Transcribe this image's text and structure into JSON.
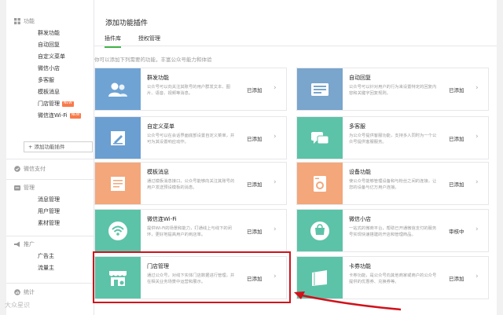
{
  "sidebar": {
    "sections": [
      {
        "label": "功能",
        "icon": "grid-icon"
      },
      {
        "label": "微信支付",
        "icon": "wallet-icon"
      },
      {
        "label": "管理",
        "icon": "folder-icon"
      },
      {
        "label": "推广",
        "icon": "megaphone-icon"
      },
      {
        "label": "统计",
        "icon": "chart-icon"
      }
    ],
    "items": [
      "群发功能",
      "自动回复",
      "自定义菜单",
      "微信小店",
      "多客服",
      "模板消息",
      "门店管理",
      "微信连Wi-Fi"
    ],
    "item_badges": {
      "6": "NEW",
      "7": "NEW"
    },
    "add_plugin": "+ 添加功能插件",
    "manage_items": [
      "消息管理",
      "用户管理",
      "素材管理"
    ],
    "promo_items": [
      "广告主",
      "流量主"
    ]
  },
  "main": {
    "title": "添加功能插件",
    "tabs": [
      "插件库",
      "授权管理"
    ],
    "intro": "你可以添加下列需要的功能，丰富公众号能力和体验"
  },
  "cards": [
    {
      "title": "群发功能",
      "desc": "公众号可以向关注其账号的用户群发文本、图片、语音、视频等消息。",
      "status": "已添加",
      "icon": "users-icon",
      "color": "#6fa3d4"
    },
    {
      "title": "自动回复",
      "desc": "公众号可以针对用户的行为来设置特定的回复内容和关键字回复规则。",
      "status": "已添加",
      "icon": "reply-icon",
      "color": "#7aa5cc"
    },
    {
      "title": "自定义菜单",
      "desc": "公众号可以在会话界面底部设置自定义菜单，并可为其设置响应动作。",
      "status": "已添加",
      "icon": "pencil-icon",
      "color": "#6b9ed1"
    },
    {
      "title": "多客服",
      "desc": "为公众号提供客服功能，支持多人同时为一个公众号提供客服服务。",
      "status": "已添加",
      "icon": "chat-icon",
      "color": "#5cc3a8"
    },
    {
      "title": "模板消息",
      "desc": "通过模板消息接口，公众号能够向关注其账号的用户发送预设模板的消息。",
      "status": "已添加",
      "icon": "document-icon",
      "color": "#f3a77a"
    },
    {
      "title": "设备功能",
      "desc": "使公众号能够管理设备和与粉丝之间的连接，让您的设备与亿万用户连接。",
      "status": "已添加",
      "icon": "washer-icon",
      "color": "#f3a77a"
    },
    {
      "title": "微信连Wi-Fi",
      "desc": "提供Wi-Fi的场景和能力，打通线上与线下的闭环，更好地提高用户的到店率。",
      "status": "已添加",
      "icon": "wifi-icon",
      "color": "#5cc3a8"
    },
    {
      "title": "微信小店",
      "desc": "一站式的微商平台，帮助已开通微信支付的服务号实现快速搭建的开店和管理商品。",
      "status": "审核中",
      "icon": "shop-icon",
      "color": "#5cc3a8"
    },
    {
      "title": "门店管理",
      "desc": "通过公众号，对线下实体门店数据进行管理，并在相关业务场景中运营和展示。",
      "status": "已添加",
      "icon": "store-icon",
      "color": "#5cc3a8"
    },
    {
      "title": "卡券功能",
      "desc": "卡券功能，是公众号向其他商家或商户的公众号提供的优惠券、兑换券等。",
      "status": "已添加",
      "icon": "card-icon",
      "color": "#5cc3a8"
    }
  ],
  "watermark": "大众星识",
  "colors": {
    "accent": "#44b549",
    "highlight": "#d0121b"
  }
}
